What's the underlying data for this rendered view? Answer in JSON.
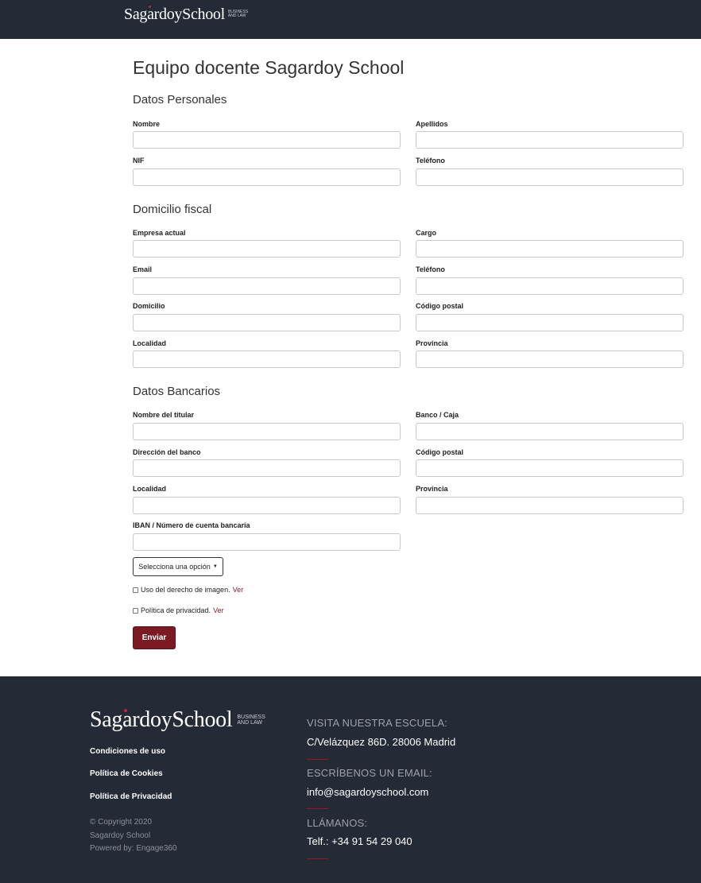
{
  "header": {
    "logo_text": "SagardoySchool",
    "logo_tagline_1": "BUSINESS",
    "logo_tagline_2": "AND LAW"
  },
  "page": {
    "title": "Equipo docente Sagardoy School"
  },
  "sections": {
    "personal": {
      "title": "Datos Personales",
      "fields": [
        "Nombre",
        "Apellidos",
        "NIF",
        "Teléfono"
      ]
    },
    "fiscal": {
      "title": "Domicilio fiscal",
      "fields": [
        "Empresa actual",
        "Cargo",
        "Email",
        "Teléfono",
        "Domicilio",
        "Código postal",
        "Localidad",
        "Provincia"
      ]
    },
    "bank": {
      "title": "Datos Bancarios",
      "fields": [
        "Nombre del titular",
        "Banco / Caja",
        "Dirección del banco",
        "Código postal",
        "Localidad",
        "Provincia",
        "IBAN / Número de cuenta bancaria"
      ]
    }
  },
  "form": {
    "select_label": "Selecciona una opción",
    "checkbox_image_label": "Uso del derecho de imagen.",
    "checkbox_image_link": "Ver",
    "checkbox_privacy_label": "Política de privacidad.",
    "checkbox_privacy_link": "Ver",
    "submit_label": "Enviar"
  },
  "footer": {
    "logo_text": "SagardoySchool",
    "logo_tagline_1": "BUSINESS",
    "logo_tagline_2": "AND LAW",
    "links": [
      "Condiciones de uso",
      "Política de Cookies",
      "Política de Privacidad"
    ],
    "copyright": [
      "© Copyright 2020",
      "Sagardoy School",
      "Powered by: Engage360"
    ],
    "contact": [
      {
        "heading": "VISITA NUESTRA ESCUELA:",
        "value": "C/Velázquez 86D. 28006 Madrid"
      },
      {
        "heading": "ESCRÍBENOS UN EMAIL:",
        "value": "info@sagardoyschool.com"
      },
      {
        "heading": "LLÁMANOS:",
        "value": "Telf.: +34 91 54 29 040"
      }
    ]
  },
  "colors": {
    "header_bg": "#252a37",
    "accent": "#7b1a22",
    "link": "#8b1b24"
  }
}
